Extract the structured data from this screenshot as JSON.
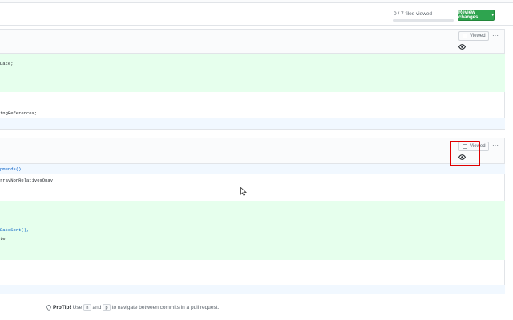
{
  "header": {
    "files_viewed": "0 / 7 files viewed",
    "review_label": "Review changes",
    "review_caret": "▾"
  },
  "file1": {
    "viewed_label": "Viewed",
    "more_label": "···",
    "lines": [
      "Date;",
      "ingReferences;"
    ]
  },
  "file2": {
    "viewed_label": "Viewed",
    "more_label": "···",
    "lines": [
      "pmends()",
      "rrayNonRelativesOnay",
      "DateSort(),",
      "te"
    ]
  },
  "protip": {
    "label": "ProTip!",
    "text_before": "Use",
    "key_n": "n",
    "text_and": "and",
    "key_p": "p",
    "text_after": "to navigate between commits in a pull request."
  },
  "colors": {
    "accent_green": "#2ea44f",
    "added_bg": "#e6ffed",
    "hunk_bg": "#f1f8ff",
    "highlight_red": "#e00000"
  }
}
